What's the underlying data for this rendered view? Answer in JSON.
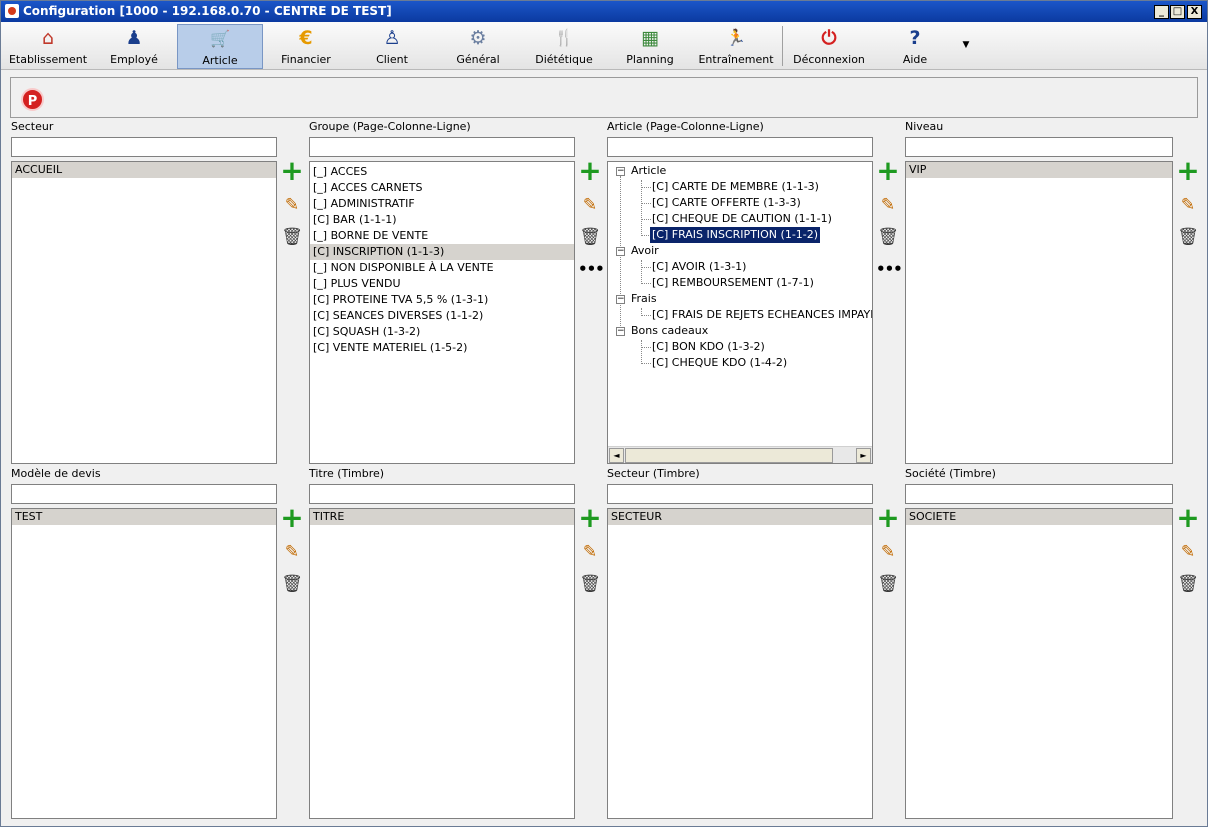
{
  "window": {
    "title": "Configuration [1000 - 192.168.0.70 - CENTRE DE TEST]",
    "min": "_",
    "max": "□",
    "close": "X"
  },
  "toolbar": [
    {
      "label": "Etablissement",
      "icon": "house-icon",
      "glyph": "⌂"
    },
    {
      "label": "Employé",
      "icon": "employee-icon",
      "glyph": "♟"
    },
    {
      "label": "Article",
      "icon": "cart-icon",
      "glyph": "🛒"
    },
    {
      "label": "Financier",
      "icon": "euro-icon",
      "glyph": "€"
    },
    {
      "label": "Client",
      "icon": "client-icon",
      "glyph": "♙"
    },
    {
      "label": "Général",
      "icon": "gear-icon",
      "glyph": "⚙"
    },
    {
      "label": "Diététique",
      "icon": "cutlery-icon",
      "glyph": "🍴"
    },
    {
      "label": "Planning",
      "icon": "calendar-icon",
      "glyph": "▦"
    },
    {
      "label": "Entraînement",
      "icon": "runner-icon",
      "glyph": "🏃"
    },
    {
      "label": "Déconnexion",
      "icon": "power-icon",
      "glyph": "⏻"
    },
    {
      "label": "Aide",
      "icon": "help-icon",
      "glyph": "?"
    }
  ],
  "toolbar_more": "▼",
  "info": {
    "badge": "P"
  },
  "panels": {
    "secteur": {
      "label": "Secteur",
      "search": "",
      "items": [
        "ACCUEIL"
      ]
    },
    "groupe": {
      "label": "Groupe (Page-Colonne-Ligne)",
      "search": "",
      "items": [
        "[_] ACCES",
        "[_] ACCES CARNETS",
        "[_] ADMINISTRATIF",
        "[C] BAR (1-1-1)",
        "[_] BORNE DE VENTE",
        "[C] INSCRIPTION (1-1-3)",
        "[_] NON DISPONIBLE À LA VENTE",
        "[_] PLUS VENDU",
        "[C] PROTEINE TVA 5,5 % (1-3-1)",
        "[C] SEANCES DIVERSES (1-1-2)",
        "[C] SQUASH (1-3-2)",
        "[C] VENTE MATERIEL (1-5-2)"
      ]
    },
    "article": {
      "label": "Article (Page-Colonne-Ligne)",
      "search": ""
    },
    "niveau": {
      "label": "Niveau",
      "search": "",
      "items": [
        "VIP"
      ]
    },
    "modele": {
      "label": "Modèle de devis",
      "search": "",
      "items": [
        "TEST"
      ]
    },
    "titre": {
      "label": "Titre (Timbre)",
      "search": "",
      "items": [
        "TITRE"
      ]
    },
    "secteur_t": {
      "label": "Secteur (Timbre)",
      "search": "",
      "items": [
        "SECTEUR"
      ]
    },
    "societe": {
      "label": "Société (Timbre)",
      "search": "",
      "items": [
        "SOCIETE"
      ]
    }
  },
  "tree": {
    "groups": [
      {
        "name": "Article",
        "items": [
          "[C] CARTE DE MEMBRE (1-1-3)",
          "[C] CARTE OFFERTE (1-3-3)",
          "[C] CHEQUE DE CAUTION (1-1-1)",
          "[C] FRAIS INSCRIPTION (1-1-2)"
        ]
      },
      {
        "name": "Avoir",
        "items": [
          "[C] AVOIR (1-3-1)",
          "[C] REMBOURSEMENT (1-7-1)"
        ]
      },
      {
        "name": "Frais",
        "items": [
          "[C] FRAIS DE REJETS ECHEANCES IMPAYER ("
        ]
      },
      {
        "name": "Bons cadeaux",
        "items": [
          "[C] BON KDO (1-3-2)",
          "[C] CHEQUE KDO (1-4-2)"
        ]
      }
    ],
    "expander": "−",
    "scroll_left": "◄",
    "scroll_right": "►"
  },
  "actions": {
    "add": "+",
    "edit": "✎",
    "delete": "🗑",
    "more": "•••"
  }
}
